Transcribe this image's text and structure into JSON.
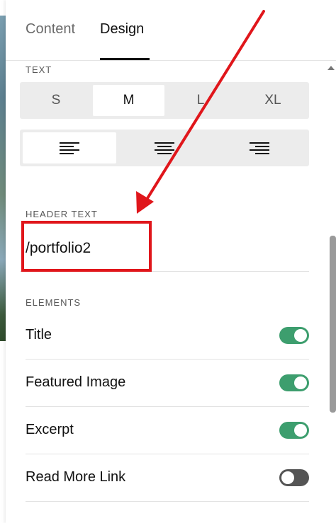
{
  "tabs": [
    {
      "label": "Content",
      "active": false
    },
    {
      "label": "Design",
      "active": true
    }
  ],
  "text_section": {
    "label": "TEXT",
    "sizes": [
      {
        "label": "S",
        "selected": false
      },
      {
        "label": "M",
        "selected": true
      },
      {
        "label": "L",
        "selected": false
      },
      {
        "label": "XL",
        "selected": false
      }
    ],
    "alignments": [
      {
        "icon": "align-left-icon",
        "selected": true
      },
      {
        "icon": "align-center-icon",
        "selected": false
      },
      {
        "icon": "align-right-icon",
        "selected": false
      }
    ]
  },
  "header_text": {
    "label": "HEADER TEXT",
    "value": "/portfolio2"
  },
  "elements": {
    "label": "ELEMENTS",
    "items": [
      {
        "label": "Title",
        "enabled": true
      },
      {
        "label": "Featured Image",
        "enabled": true
      },
      {
        "label": "Excerpt",
        "enabled": true
      },
      {
        "label": "Read More Link",
        "enabled": false
      }
    ]
  },
  "colors": {
    "toggle_on": "#3d9e6e",
    "toggle_off": "#555555",
    "annotation": "#e0161b"
  }
}
